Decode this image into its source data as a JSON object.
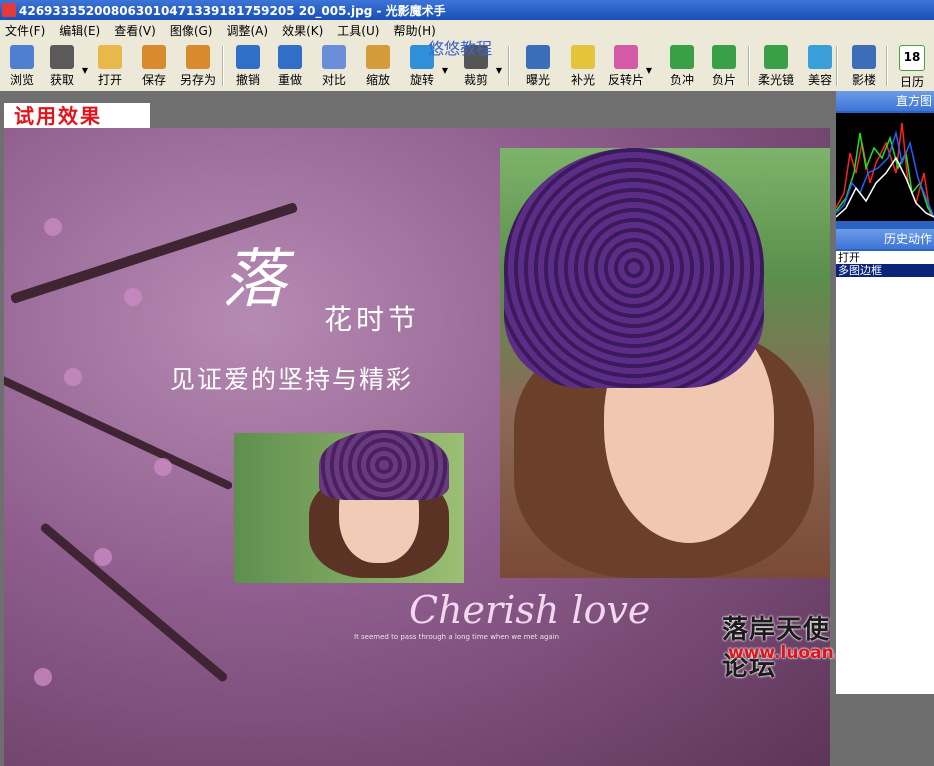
{
  "window": {
    "title": "426933352008063010471339181759205 20_005.jpg - 光影魔术手"
  },
  "menu": [
    {
      "label": "文件(F)"
    },
    {
      "label": "编辑(E)"
    },
    {
      "label": "查看(V)"
    },
    {
      "label": "图像(G)"
    },
    {
      "label": "调整(A)"
    },
    {
      "label": "效果(K)"
    },
    {
      "label": "工具(U)"
    },
    {
      "label": "帮助(H)"
    }
  ],
  "toolbar": {
    "buttons": [
      {
        "label": "浏览",
        "icon": "browse-icon",
        "color": "#4f7fd0"
      },
      {
        "label": "获取",
        "icon": "camera-icon",
        "color": "#5a5a5a"
      },
      {
        "label": "打开",
        "icon": "folder-icon",
        "color": "#e9b84a"
      },
      {
        "label": "保存",
        "icon": "save-icon",
        "color": "#d98a2c"
      },
      {
        "label": "另存为",
        "icon": "save-as-icon",
        "color": "#d98a2c"
      },
      {
        "label": "撤销",
        "icon": "undo-icon",
        "color": "#2f6fc8"
      },
      {
        "label": "重做",
        "icon": "redo-icon",
        "color": "#2f6fc8"
      },
      {
        "label": "对比",
        "icon": "compare-icon",
        "color": "#6a8fd8"
      },
      {
        "label": "缩放",
        "icon": "zoom-icon",
        "color": "#d49b3a"
      },
      {
        "label": "旋转",
        "icon": "rotate-icon",
        "color": "#2f8fd8"
      },
      {
        "label": "裁剪",
        "icon": "crop-icon",
        "color": "#555555"
      },
      {
        "label": "曝光",
        "icon": "exposure-icon",
        "color": "#3a6fb8"
      },
      {
        "label": "补光",
        "icon": "fill-light-icon",
        "color": "#e3c43a"
      },
      {
        "label": "反转片",
        "icon": "reverse-film-icon",
        "color": "#d45aa8"
      },
      {
        "label": "负冲",
        "icon": "cross-process-icon",
        "color": "#3aa048"
      },
      {
        "label": "负片",
        "icon": "negative-icon",
        "color": "#3aa048"
      },
      {
        "label": "柔光镜",
        "icon": "soft-light-icon",
        "color": "#3aa048"
      },
      {
        "label": "美容",
        "icon": "beauty-icon",
        "color": "#3a9fd8"
      },
      {
        "label": "影楼",
        "icon": "studio-icon",
        "color": "#3a6fb8"
      },
      {
        "label": "日历",
        "icon": "calendar-icon",
        "color": "#4aa048"
      }
    ],
    "calendar_day": "18"
  },
  "overlay_watermark": "悠悠教程",
  "canvas": {
    "trial_badge": "试用效果",
    "photo_text": {
      "big_char": "落",
      "subtitle": "花时节",
      "slogan": "见证爱的坚持与精彩",
      "cherish": "Cherish love",
      "cherish_sub": "It seemed to pass through a long time when we met again"
    },
    "forum_name": "落岸天使论坛",
    "forum_url": "www.luoan.cn"
  },
  "right_panel": {
    "histogram_label": "直方图",
    "history_label": "历史动作",
    "history_items": [
      {
        "label": "打开",
        "selected": false
      },
      {
        "label": "多图边框",
        "selected": true
      }
    ]
  }
}
